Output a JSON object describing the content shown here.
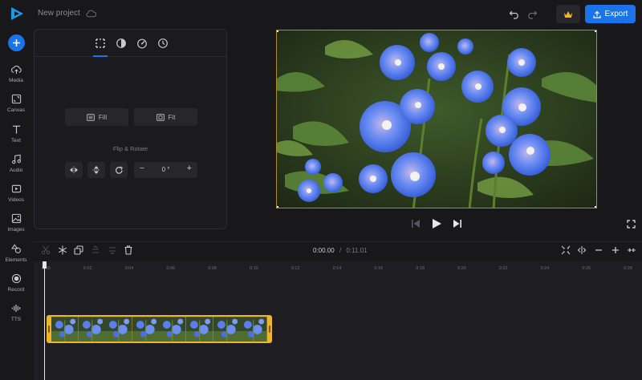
{
  "header": {
    "project_name": "New project",
    "export_label": "Export"
  },
  "sidebar": {
    "items": [
      {
        "label": "Media",
        "icon": "cloud-upload-icon"
      },
      {
        "label": "Canvas",
        "icon": "canvas-resize-icon"
      },
      {
        "label": "Text",
        "icon": "text-icon"
      },
      {
        "label": "Audio",
        "icon": "music-note-icon"
      },
      {
        "label": "Videos",
        "icon": "video-icon"
      },
      {
        "label": "Images",
        "icon": "image-icon"
      },
      {
        "label": "Elements",
        "icon": "shapes-icon"
      },
      {
        "label": "Record",
        "icon": "record-icon"
      },
      {
        "label": "TTS",
        "icon": "waveform-icon"
      }
    ]
  },
  "panel": {
    "fill_label": "Fill",
    "fit_label": "Fit",
    "flip_rotate_label": "Flip & Rotate",
    "rotation_value": "0 °"
  },
  "timeline": {
    "current_time": "0:00.00",
    "separator": "/",
    "total_time": "0:11.01",
    "ruler": [
      "0:00",
      "0:02",
      "0:04",
      "0:06",
      "0:08",
      "0:10",
      "0:12",
      "0:14",
      "0:16",
      "0:18",
      "0:20",
      "0:22",
      "0:24",
      "0:26",
      "0:28"
    ]
  },
  "colors": {
    "accent": "#1a73e8",
    "clip_border": "#f0b429",
    "background": "#18181b"
  }
}
